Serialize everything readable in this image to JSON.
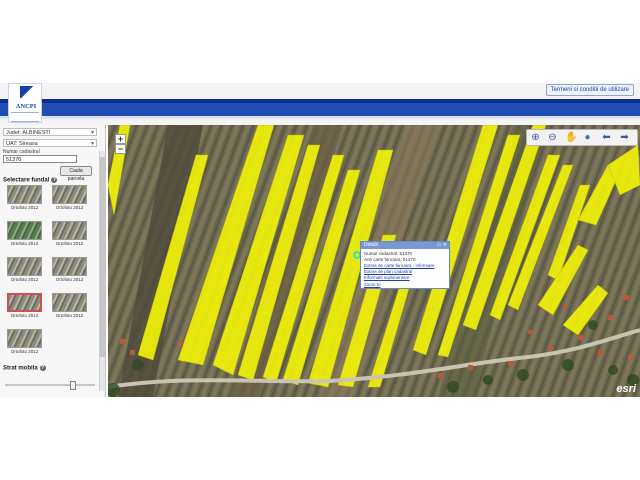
{
  "header": {
    "logo_text": "ANCPI",
    "top_link": "Termeni si conditii de utilizare"
  },
  "panel": {
    "county_select": "Judet: ALBINESTI",
    "uat_select": "UAT: Sireasa",
    "search_label": "Numar cadastral",
    "search_value": "51370",
    "search_button": "Cauta parcela",
    "basemap_section": "Selectare fundal",
    "thumbs": [
      {
        "caption": "Ortofoto 2012",
        "style": "gray"
      },
      {
        "caption": "Ortofoto 2012",
        "style": "gray"
      },
      {
        "caption": "Ortofoto 2012",
        "style": "green"
      },
      {
        "caption": "Ortofoto 2012",
        "style": "gray"
      },
      {
        "caption": "Ortofoto 2012",
        "style": "gray"
      },
      {
        "caption": "Ortofoto 2012",
        "style": "gray"
      },
      {
        "caption": "Ortofoto 2012",
        "style": "selected"
      },
      {
        "caption": "Ortofoto 2012",
        "style": "gray"
      },
      {
        "caption": "Ortofoto 2012",
        "style": "gray"
      }
    ],
    "opacity_section": "Strat mobila",
    "opacity_level": 0.75
  },
  "map": {
    "zoom_in": "+",
    "zoom_out": "−",
    "attribution": "esri",
    "tools": [
      "zoom-in-icon",
      "zoom-out-icon",
      "pan-hand-icon",
      "globe-icon",
      "back-arrow-icon",
      "forward-arrow-icon"
    ]
  },
  "popup": {
    "title": "Detalii",
    "rows": [
      "Numar cadastral: 51370",
      "Arie carte funciara: 51370",
      "Extras de carte funciara - informare",
      "Extras de plan cadastral",
      "Informatii suplimentare",
      "Zoom to"
    ]
  },
  "colors": {
    "brand_blue": "#1f4fb6",
    "parcel_yellow": "#f1f20a",
    "popup_header": "#7a98d6"
  }
}
